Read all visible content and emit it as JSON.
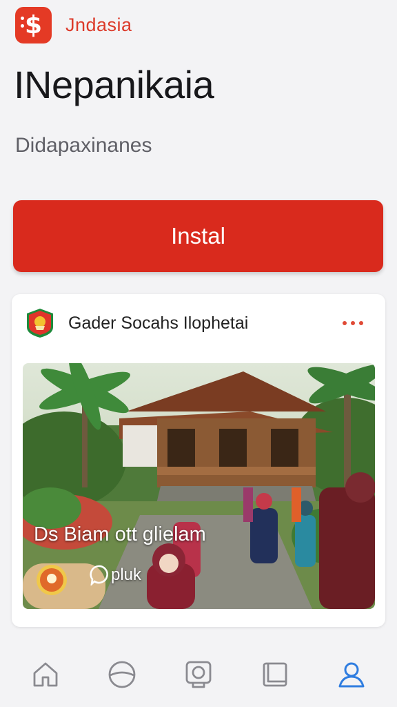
{
  "header": {
    "logo_icon": "dollar-app-icon",
    "brand_name": "Jndasia",
    "brand_color": "#dc3a2a"
  },
  "page": {
    "title": "INepanikaia",
    "subtitle": "Didapaxinanes"
  },
  "install": {
    "label": "Instal",
    "color": "#d92a1d"
  },
  "post": {
    "channel_name": "Gader Socahs Ilophetai",
    "channel_icon": "shield-emblem-icon",
    "more_icon": "more-dots-icon",
    "image_caption": "Ds Biam ott glielam",
    "tag_label": "pluk",
    "tag_icon": "chat-bubble-icon",
    "badge_icon": "badge-emblem-icon"
  },
  "bottom_nav": {
    "items": [
      {
        "icon": "home-icon",
        "active": false
      },
      {
        "icon": "explore-icon",
        "active": false
      },
      {
        "icon": "wallet-icon",
        "active": false
      },
      {
        "icon": "book-icon",
        "active": false
      },
      {
        "icon": "profile-icon",
        "active": true
      }
    ],
    "active_color": "#2f7de0",
    "inactive_color": "#8a8a90"
  }
}
